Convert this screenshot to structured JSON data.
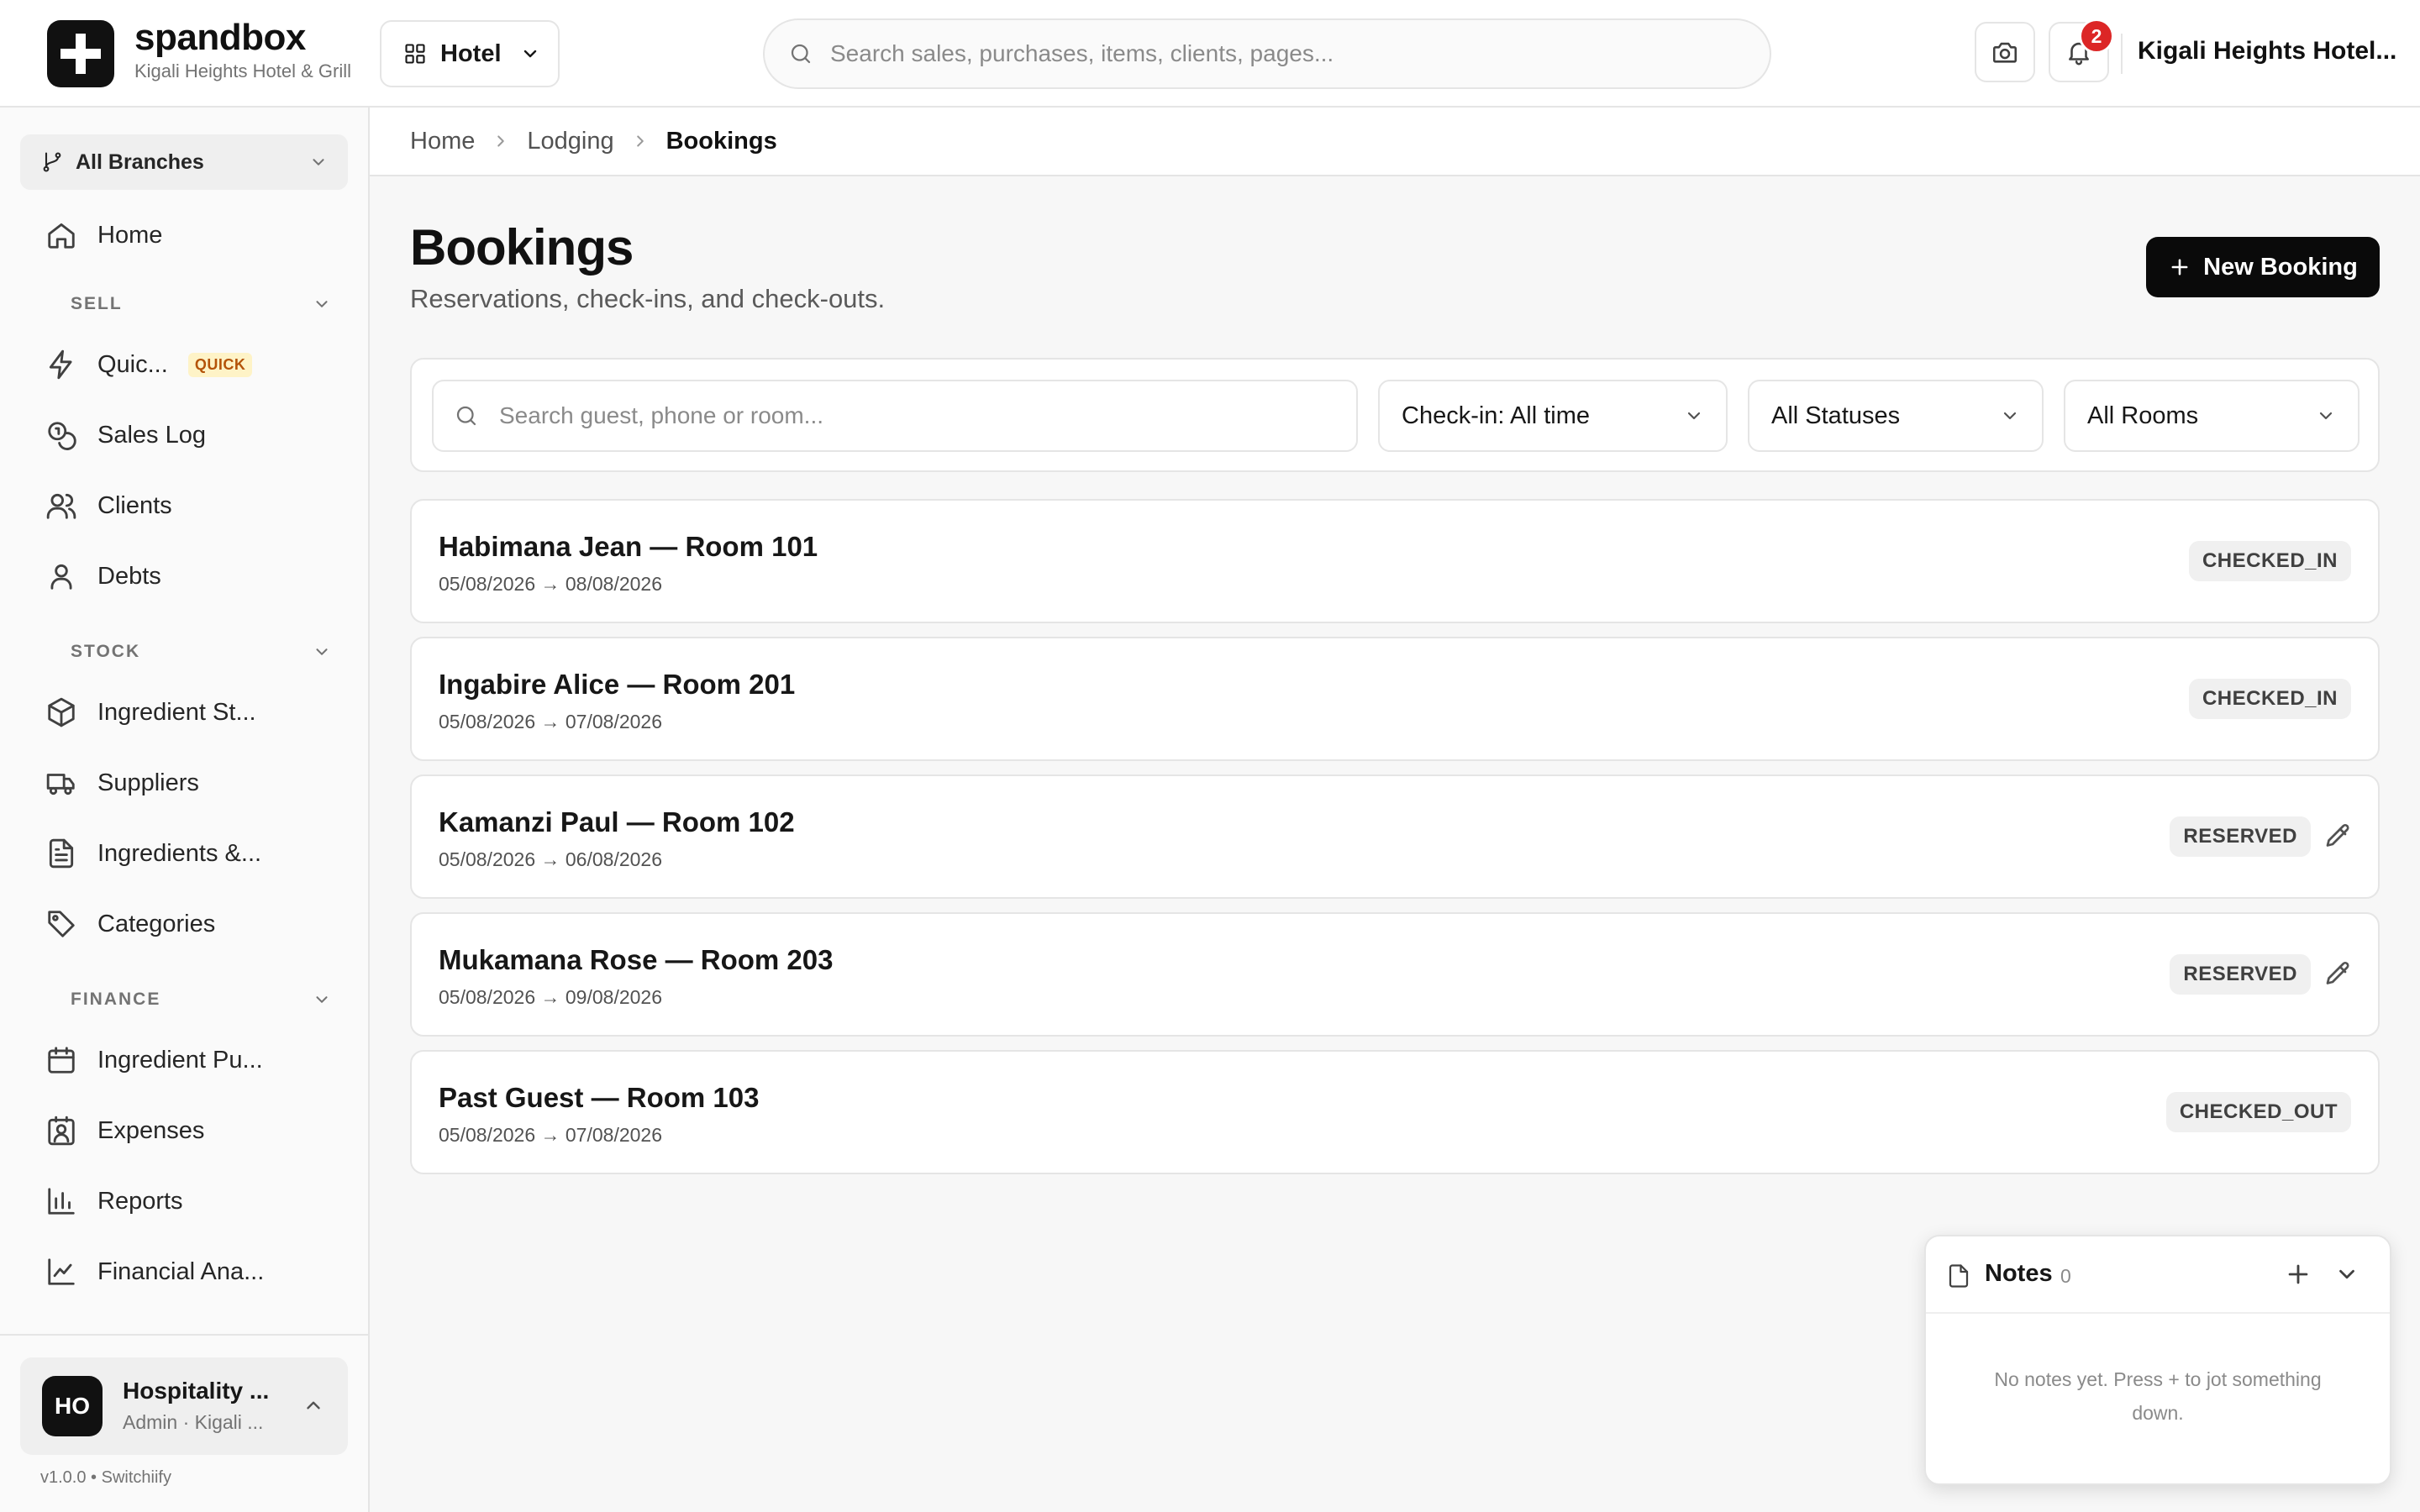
{
  "header": {
    "brand_name": "spandbox",
    "brand_sub": "Kigali Heights Hotel & Grill",
    "module_label": "Hotel",
    "search_placeholder": "Search sales, purchases, items, clients, pages...",
    "notification_count": "2",
    "hotel_name": "Kigali Heights Hotel..."
  },
  "sidebar": {
    "branch_label": "All Branches",
    "home_label": "Home",
    "sections": {
      "sell": "SELL",
      "stock": "STOCK",
      "finance": "FINANCE"
    },
    "quick_label": "Quic...",
    "quick_badge": "QUICK",
    "sales_log": "Sales Log",
    "clients": "Clients",
    "debts": "Debts",
    "ingredient_stock": "Ingredient St...",
    "suppliers": "Suppliers",
    "ingredients": "Ingredients &...",
    "categories": "Categories",
    "ingredient_purchases": "Ingredient Pu...",
    "expenses": "Expenses",
    "reports": "Reports",
    "financial_analysis": "Financial Ana...",
    "user": {
      "initials": "HO",
      "name": "Hospitality ...",
      "role": "Admin · Kigali ..."
    },
    "version": "v1.0.0 • Switchiify"
  },
  "breadcrumb": {
    "home": "Home",
    "lodging": "Lodging",
    "current": "Bookings"
  },
  "page": {
    "title": "Bookings",
    "subtitle": "Reservations, check-ins, and check-outs.",
    "new_button": "New Booking"
  },
  "filters": {
    "search_placeholder": "Search guest, phone or room...",
    "checkin": "Check-in: All time",
    "status": "All Statuses",
    "rooms": "All Rooms"
  },
  "bookings": [
    {
      "title": "Habimana Jean — Room 101",
      "dates": "05/08/2026 → 08/08/2026",
      "status": "CHECKED_IN"
    },
    {
      "title": "Ingabire Alice — Room 201",
      "dates": "05/08/2026 → 07/08/2026",
      "status": "CHECKED_IN"
    },
    {
      "title": "Kamanzi Paul — Room 102",
      "dates": "05/08/2026 → 06/08/2026",
      "status": "RESERVED"
    },
    {
      "title": "Mukamana Rose — Room 203",
      "dates": "05/08/2026 → 09/08/2026",
      "status": "RESERVED"
    },
    {
      "title": "Past Guest — Room 103",
      "dates": "05/08/2026 → 07/08/2026",
      "status": "CHECKED_OUT"
    }
  ],
  "notes": {
    "title": "Notes",
    "count": "0",
    "empty_text": "No notes yet. Press + to jot something down."
  },
  "colors": {
    "primary": "#0a0a0a",
    "badge": "#dc2626",
    "quick_badge_text": "#b45309",
    "quick_badge_bg": "#fef3c7"
  }
}
